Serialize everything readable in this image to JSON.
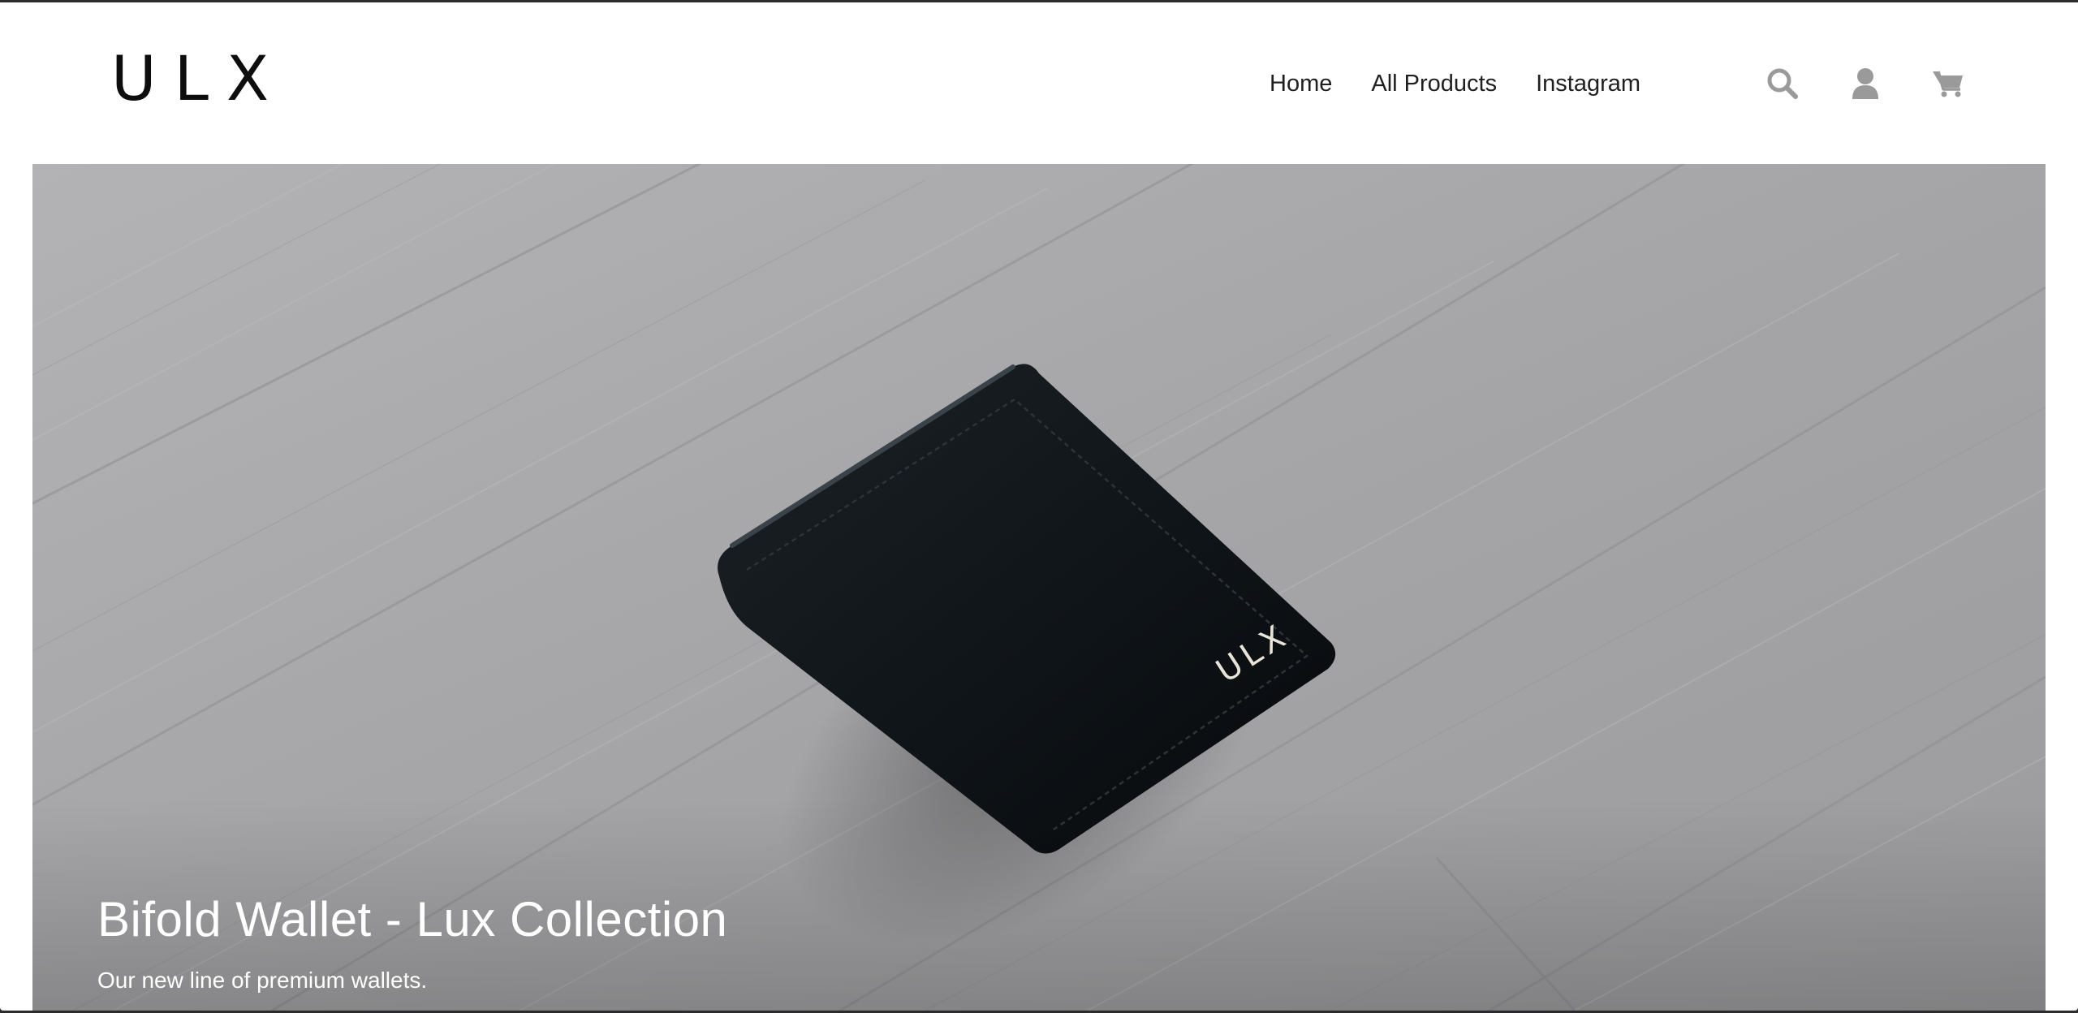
{
  "brand": {
    "logo_text": "ULX"
  },
  "nav": {
    "items": [
      {
        "label": "Home"
      },
      {
        "label": "All Products"
      },
      {
        "label": "Instagram"
      }
    ]
  },
  "header_icons": {
    "search": "search-icon",
    "account": "user-icon",
    "cart": "cart-icon",
    "icon_color": "#9a9a9a"
  },
  "hero": {
    "title": "Bifold Wallet - Lux Collection",
    "subtitle": "Our new line of premium wallets.",
    "wallet_emboss": "ULX",
    "floor_color": "#a9a9ab",
    "wallet_color": "#0f1418"
  }
}
